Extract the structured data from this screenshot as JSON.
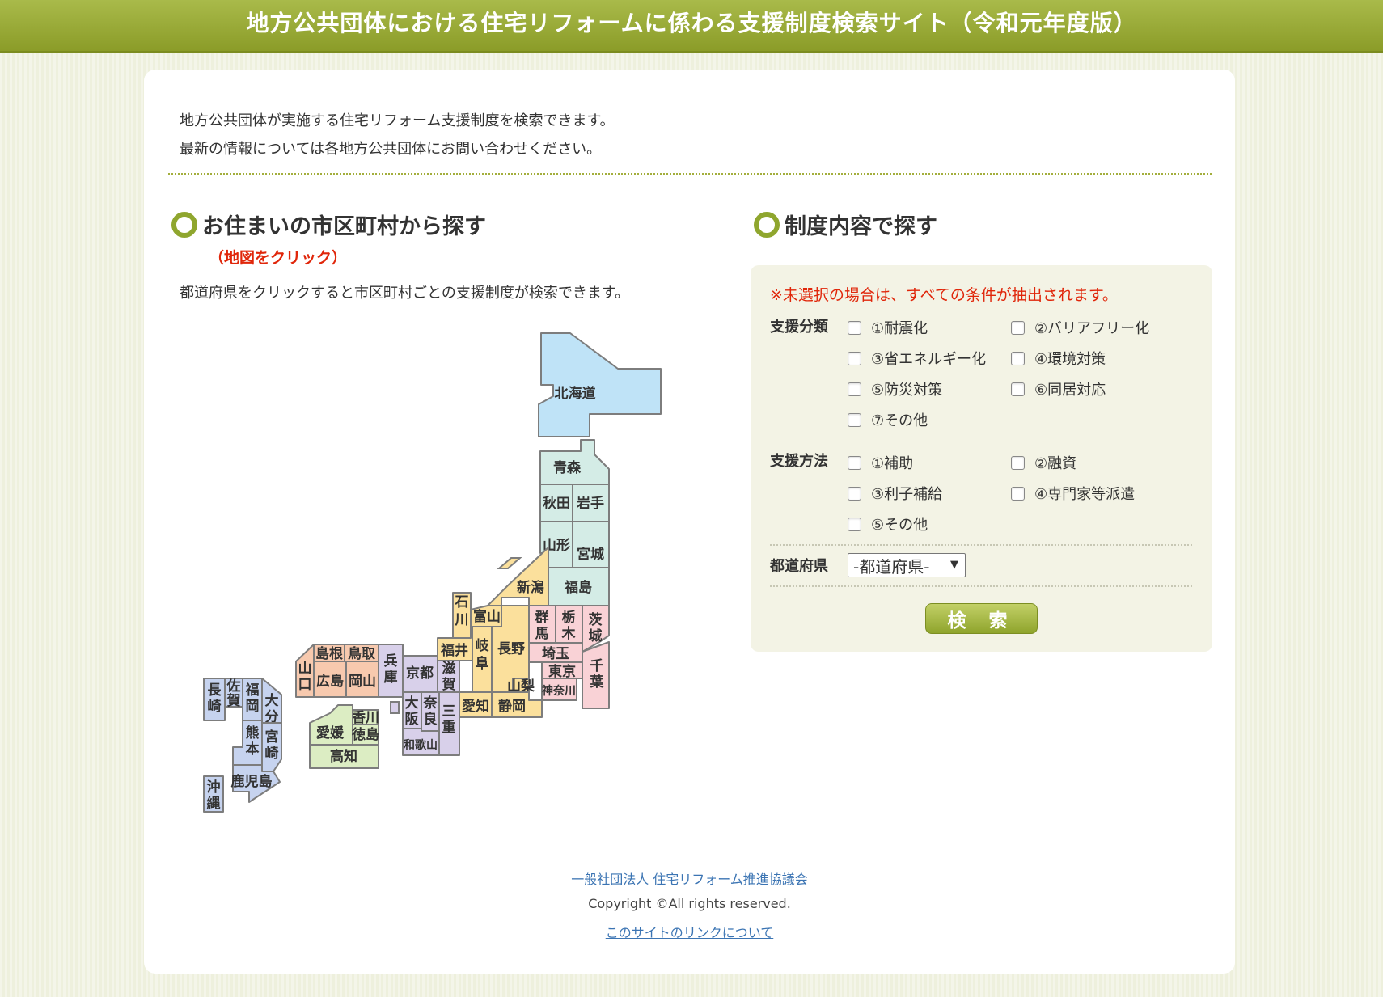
{
  "header": {
    "title": "地方公共団体における住宅リフォームに係わる支援制度検索サイト（令和元年度版）"
  },
  "intro": {
    "line1": "地方公共団体が実施する住宅リフォーム支援制度を検索できます。",
    "line2": "最新の情報については各地方公共団体にお問い合わせください。"
  },
  "map_section": {
    "title": "お住まいの市区町村から探す",
    "note": "（地図をクリック）",
    "description": "都道府県をクリックすると市区町村ごとの支援制度が検索できます。",
    "prefectures": [
      {
        "id": "hokkaido",
        "label": "北海道",
        "color": "#bfe3f7"
      },
      {
        "id": "aomori",
        "label": "青森",
        "color": "#d4ece6"
      },
      {
        "id": "akita",
        "label": "秋田",
        "color": "#d4ece6"
      },
      {
        "id": "iwate",
        "label": "岩手",
        "color": "#d4ece6"
      },
      {
        "id": "yamagata",
        "label": "山形",
        "color": "#d4ece6"
      },
      {
        "id": "miyagi",
        "label": "宮城",
        "color": "#d4ece6"
      },
      {
        "id": "fukushima",
        "label": "福島",
        "color": "#d4ece6"
      },
      {
        "id": "niigata",
        "label": "新潟",
        "color": "#fbe09c"
      },
      {
        "id": "ishikawa",
        "label": "石川",
        "color": "#fbe09c"
      },
      {
        "id": "toyama",
        "label": "富山",
        "color": "#fbe09c"
      },
      {
        "id": "fukui",
        "label": "福井",
        "color": "#fbe09c"
      },
      {
        "id": "nagano",
        "label": "長野",
        "color": "#fbe09c"
      },
      {
        "id": "gifu",
        "label": "岐阜",
        "color": "#fbe09c"
      },
      {
        "id": "yamanashi",
        "label": "山梨",
        "color": "#fbe09c"
      },
      {
        "id": "aichi",
        "label": "愛知",
        "color": "#fbe09c"
      },
      {
        "id": "shizuoka",
        "label": "静岡",
        "color": "#fbe09c"
      },
      {
        "id": "gunma",
        "label": "群馬",
        "color": "#f9d2d6"
      },
      {
        "id": "tochigi",
        "label": "栃木",
        "color": "#f9d2d6"
      },
      {
        "id": "ibaraki",
        "label": "茨城",
        "color": "#f9d2d6"
      },
      {
        "id": "saitama",
        "label": "埼玉",
        "color": "#f9d2d6"
      },
      {
        "id": "tokyo",
        "label": "東京",
        "color": "#f9d2d6"
      },
      {
        "id": "chiba",
        "label": "千葉",
        "color": "#f9d2d6"
      },
      {
        "id": "kanagawa",
        "label": "神奈川",
        "color": "#f9d2d6"
      },
      {
        "id": "shiga",
        "label": "滋賀",
        "color": "#d8d0ea"
      },
      {
        "id": "kyoto",
        "label": "京都",
        "color": "#d8d0ea"
      },
      {
        "id": "hyogo",
        "label": "兵庫",
        "color": "#d8d0ea"
      },
      {
        "id": "osaka",
        "label": "大阪",
        "color": "#d8d0ea"
      },
      {
        "id": "nara",
        "label": "奈良",
        "color": "#d8d0ea"
      },
      {
        "id": "mie",
        "label": "三重",
        "color": "#d8d0ea"
      },
      {
        "id": "wakayama",
        "label": "和歌山",
        "color": "#d8d0ea"
      },
      {
        "id": "shimane",
        "label": "島根",
        "color": "#f7c9ae"
      },
      {
        "id": "tottori",
        "label": "鳥取",
        "color": "#f7c9ae"
      },
      {
        "id": "yamaguchi",
        "label": "山口",
        "color": "#f7c9ae"
      },
      {
        "id": "hiroshima",
        "label": "広島",
        "color": "#f7c9ae"
      },
      {
        "id": "okayama",
        "label": "岡山",
        "color": "#f7c9ae"
      },
      {
        "id": "kagawa",
        "label": "香川",
        "color": "#dcedc3"
      },
      {
        "id": "ehime",
        "label": "愛媛",
        "color": "#dcedc3"
      },
      {
        "id": "tokushima",
        "label": "徳島",
        "color": "#dcedc3"
      },
      {
        "id": "kochi",
        "label": "高知",
        "color": "#dcedc3"
      },
      {
        "id": "nagasaki",
        "label": "長崎",
        "color": "#c6d3ef"
      },
      {
        "id": "saga",
        "label": "佐賀",
        "color": "#c6d3ef"
      },
      {
        "id": "fukuoka",
        "label": "福岡",
        "color": "#c6d3ef"
      },
      {
        "id": "oita",
        "label": "大分",
        "color": "#c6d3ef"
      },
      {
        "id": "kumamoto",
        "label": "熊本",
        "color": "#c6d3ef"
      },
      {
        "id": "miyazaki",
        "label": "宮崎",
        "color": "#c6d3ef"
      },
      {
        "id": "kagoshima",
        "label": "鹿児島",
        "color": "#c6d3ef"
      },
      {
        "id": "okinawa",
        "label": "沖縄",
        "color": "#c6d3ef"
      }
    ]
  },
  "content_section": {
    "title": "制度内容で探す",
    "warning": "※未選択の場合は、すべての条件が抽出されます。",
    "category": {
      "label": "支援分類",
      "options": [
        "①耐震化",
        "②バリアフリー化",
        "③省エネルギー化",
        "④環境対策",
        "⑤防災対策",
        "⑥同居対応",
        "⑦その他"
      ]
    },
    "method": {
      "label": "支援方法",
      "options": [
        "①補助",
        "②融資",
        "③利子補給",
        "④専門家等派遣",
        "⑤その他"
      ]
    },
    "prefecture_select": {
      "label": "都道府県",
      "value": "-都道府県-"
    },
    "search_button": "検 索"
  },
  "footer": {
    "org_link": "一般社団法人 住宅リフォーム推進協議会",
    "copyright": "Copyright ©All rights reserved.",
    "link_policy": "このサイトのリンクについて"
  }
}
